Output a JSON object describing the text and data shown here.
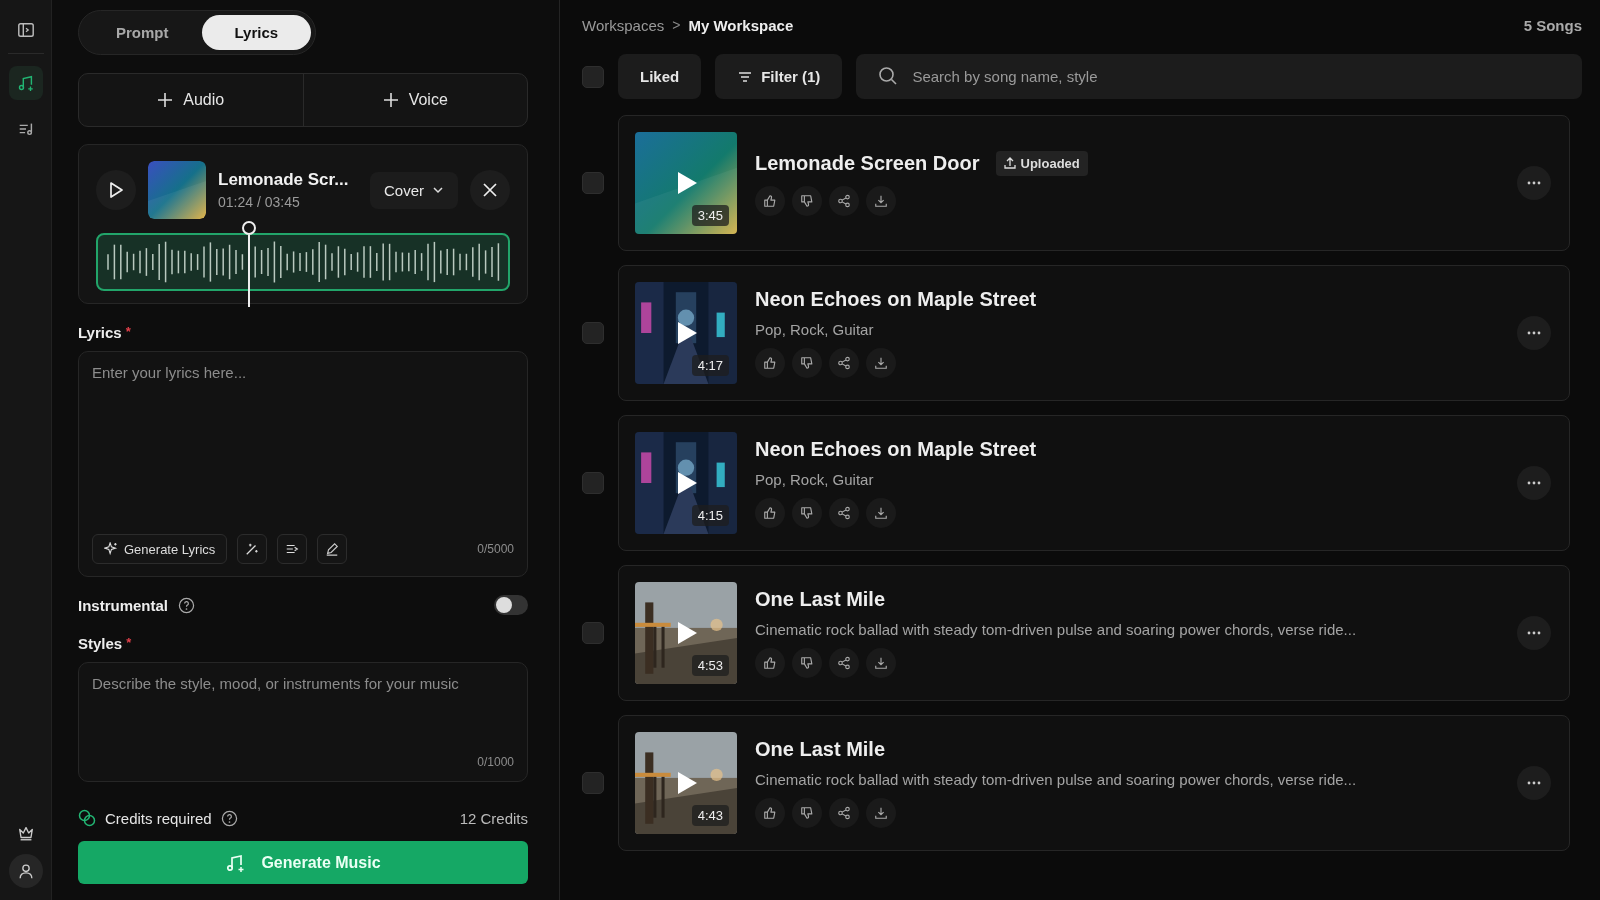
{
  "sidebar": {
    "items": [
      {
        "kind": "create",
        "selected": true
      },
      {
        "kind": "library",
        "selected": false
      }
    ]
  },
  "mode_tabs": [
    {
      "label": "Prompt",
      "selected": false
    },
    {
      "label": "Lyrics",
      "selected": true
    }
  ],
  "add_buttons": [
    "Audio",
    "Voice"
  ],
  "player": {
    "title": "Lemonade Scr...",
    "time": "01:24 / 03:45",
    "mode": "Cover",
    "level": 0.37
  },
  "lyrics": {
    "label": "Lyrics",
    "required_mark": "*",
    "placeholder": "Enter your lyrics here...",
    "generate": "Generate Lyrics",
    "count": "0/5000"
  },
  "instrumental": {
    "label": "Instrumental",
    "on": false
  },
  "styles": {
    "label": "Styles",
    "required_mark": "*",
    "placeholder": "Describe the style, mood, or instruments for your music",
    "count": "0/1000"
  },
  "credits": {
    "label": "Credits required",
    "value": "12 Credits"
  },
  "generate_button": "Generate Music",
  "breadcrumb": {
    "items": [
      "Workspaces",
      "My Workspace"
    ],
    "separator": ">"
  },
  "song_count": "5 Songs",
  "toolbar": {
    "select_all_checked": false,
    "liked": "Liked",
    "filter": "Filter (1)",
    "search_placeholder": "Search by song name, style"
  },
  "songs": [
    {
      "title": "Lemonade Screen Door",
      "badge": "Uploaded",
      "duration": "3:45",
      "selected": false
    },
    {
      "title": "Neon Echoes on Maple Street",
      "subtitle": "Pop, Rock, Guitar",
      "duration": "4:17",
      "selected": false
    },
    {
      "title": "Neon Echoes on Maple Street",
      "subtitle": "Pop, Rock, Guitar",
      "duration": "4:15",
      "selected": false
    },
    {
      "title": "One Last Mile",
      "subtitle": "Cinematic rock ballad with steady tom-driven pulse and soaring power chords, verse ride...",
      "duration": "4:53",
      "selected": false
    },
    {
      "title": "One Last Mile",
      "subtitle": "Cinematic rock ballad with steady tom-driven pulse and soaring power chords, verse ride...",
      "duration": "4:43",
      "selected": false
    }
  ]
}
